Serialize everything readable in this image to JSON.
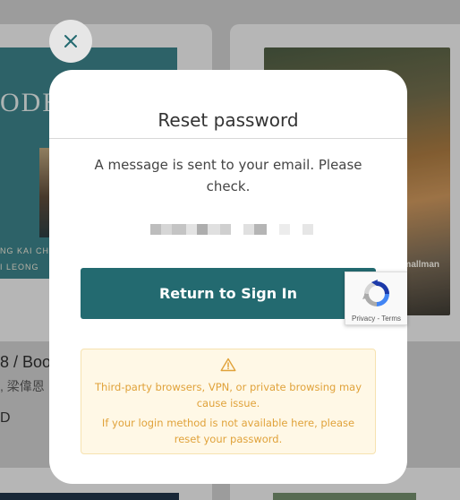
{
  "background": {
    "left_cover_title": "ODH",
    "left_cover_line1": "NG KAI CH",
    "left_cover_line2": "I LEONG",
    "left_book_title": "8 / Boo",
    "left_book_author": ", 梁偉恩",
    "left_book_extra": "D",
    "right_cover_brand": "mallman"
  },
  "modal": {
    "close_icon": "close-icon",
    "title": "Reset password",
    "message": "A message is sent to your email. Please check.",
    "primary_button": "Return to Sign In",
    "notice": {
      "icon": "warning-icon",
      "line1": "Third-party browsers, VPN, or private browsing may cause issue.",
      "line2": "If your login method is not available here, please reset your password."
    }
  },
  "recaptcha": {
    "privacy": "Privacy",
    "separator": " - ",
    "terms": "Terms"
  },
  "colors": {
    "primary": "#236a70",
    "notice_bg": "#fff8e6",
    "notice_text": "#e0a23a"
  }
}
